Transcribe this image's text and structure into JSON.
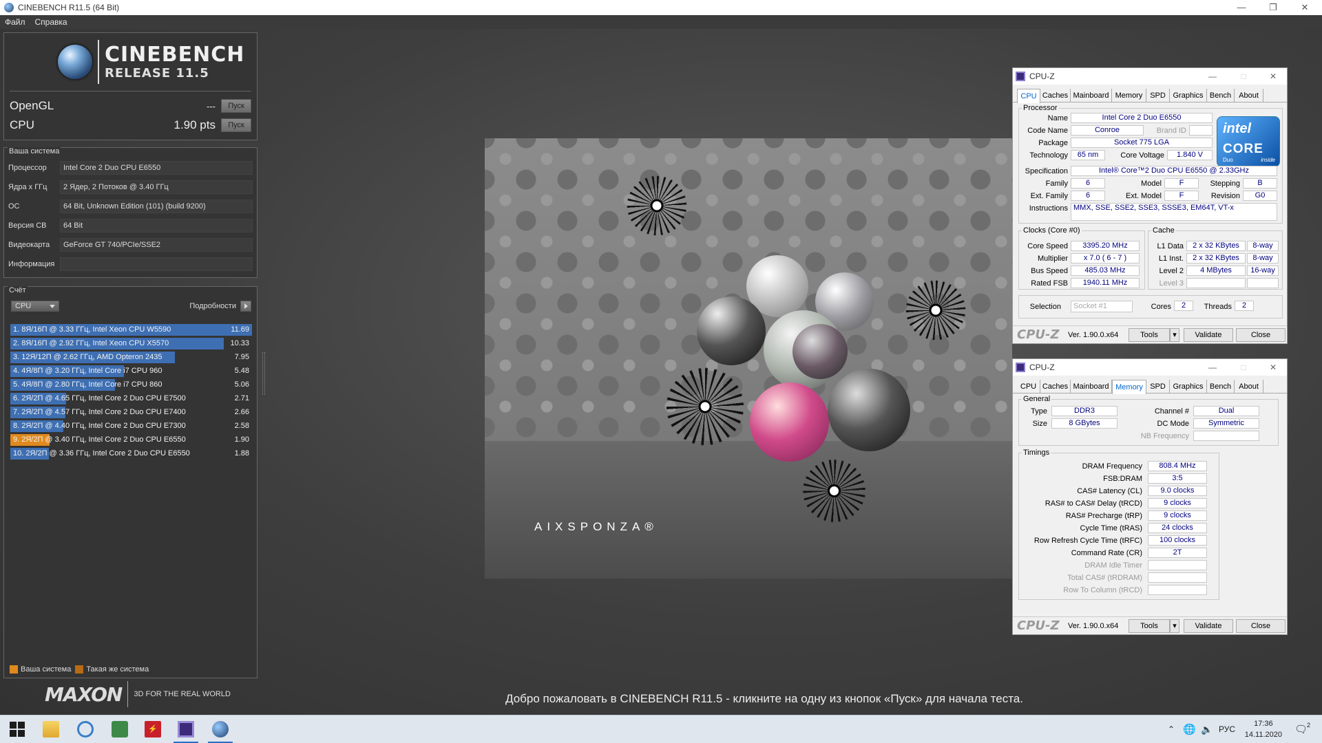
{
  "window": {
    "title": "CINEBENCH R11.5 (64 Bit)"
  },
  "menu": [
    "Файл",
    "Справка"
  ],
  "logo": {
    "line1": "CINEBENCH",
    "line2": "RELEASE 11.5"
  },
  "tests": [
    {
      "name": "OpenGL",
      "score": "---",
      "button": "Пуск"
    },
    {
      "name": "CPU",
      "score": "1.90 pts",
      "button": "Пуск"
    }
  ],
  "system": {
    "title": "Ваша система",
    "rows": [
      {
        "label": "Процессор",
        "value": "Intel Core 2 Duo CPU E6550"
      },
      {
        "label": "Ядра x ГГц",
        "value": "2 Ядер, 2 Потоков @ 3.40 ГГц"
      },
      {
        "label": "ОС",
        "value": "64 Bit, Unknown Edition (101) (build 9200)"
      },
      {
        "label": "Версия СВ",
        "value": "64 Bit"
      },
      {
        "label": "Видеокарта",
        "value": "GeForce GT 740/PCIe/SSE2"
      },
      {
        "label": "Информация",
        "value": ""
      }
    ]
  },
  "score": {
    "title": "Счёт",
    "select": "CPU",
    "details": "Подробности",
    "max": 11.69,
    "ranking": [
      {
        "label": "1. 8Я/16П @ 3.33 ГГц, Intel Xeon CPU W5590",
        "value": 11.69,
        "mine": false
      },
      {
        "label": "2. 8Я/16П @ 2.92 ГГц, Intel Xeon CPU X5570",
        "value": 10.33,
        "mine": false
      },
      {
        "label": "3. 12Я/12П @ 2.62 ГГц, AMD Opteron 2435",
        "value": 7.95,
        "mine": false
      },
      {
        "label": "4. 4Я/8П @ 3.20 ГГц, Intel Core i7 CPU 960",
        "value": 5.48,
        "mine": false
      },
      {
        "label": "5. 4Я/8П @ 2.80 ГГц, Intel Core i7 CPU 860",
        "value": 5.06,
        "mine": false
      },
      {
        "label": "6. 2Я/2П @ 4.65 ГГц, Intel Core 2 Duo CPU E7500",
        "value": 2.71,
        "mine": false
      },
      {
        "label": "7. 2Я/2П @ 4.57 ГГц, Intel Core 2 Duo CPU E7400",
        "value": 2.66,
        "mine": false
      },
      {
        "label": "8. 2Я/2П @ 4.40 ГГц, Intel Core 2 Duo CPU E7300",
        "value": 2.58,
        "mine": false
      },
      {
        "label": "9. 2Я/2П @ 3.40 ГГц, Intel Core 2 Duo CPU E6550",
        "value": 1.9,
        "mine": true
      },
      {
        "label": "10. 2Я/2П @ 3.36 ГГц, Intel Core 2 Duo CPU E6550",
        "value": 1.88,
        "mine": false
      }
    ],
    "legend": [
      {
        "label": "Ваша система",
        "color": "#e08a1e"
      },
      {
        "label": "Такая же система",
        "color": "#b86a14"
      }
    ]
  },
  "maxon": {
    "logo": "MAXON",
    "tagline": "3D FOR THE REAL WORLD"
  },
  "welcome": "Добро пожаловать в CINEBENCH R11.5 - кликните на одну из кнопок «Пуск» для начала теста.",
  "render": {
    "brand": "AIXSPONZA®"
  },
  "cpuz1": {
    "title": "CPU-Z",
    "tabs": [
      "CPU",
      "Caches",
      "Mainboard",
      "Memory",
      "SPD",
      "Graphics",
      "Bench",
      "About"
    ],
    "active": 0,
    "processor": {
      "title": "Processor",
      "name_label": "Name",
      "name": "Intel Core 2 Duo E6550",
      "code_label": "Code Name",
      "code": "Conroe",
      "brand_label": "Brand ID",
      "package_label": "Package",
      "package": "Socket 775 LGA",
      "tech_label": "Technology",
      "tech": "65 nm",
      "voltage_label": "Core Voltage",
      "voltage": "1.840 V",
      "spec_label": "Specification",
      "spec": "Intel® Core™2 Duo CPU     E6550  @ 2.33GHz",
      "family_label": "Family",
      "family": "6",
      "model_label": "Model",
      "model": "F",
      "stepping_label": "Stepping",
      "stepping": "B",
      "extfam_label": "Ext. Family",
      "extfam": "6",
      "extmodel_label": "Ext. Model",
      "extmodel": "F",
      "revision_label": "Revision",
      "revision": "G0",
      "instr_label": "Instructions",
      "instr": "MMX, SSE, SSE2, SSE3, SSSE3, EM64T, VT-x"
    },
    "intel": {
      "brand": "intel",
      "core": "CORE",
      "duo": "Duo",
      "inside": "inside"
    },
    "clocks": {
      "title": "Clocks (Core #0)",
      "speed_label": "Core Speed",
      "speed": "3395.20 MHz",
      "mult_label": "Multiplier",
      "mult": "x 7.0 ( 6 - 7 )",
      "bus_label": "Bus Speed",
      "bus": "485.03 MHz",
      "fsb_label": "Rated FSB",
      "fsb": "1940.11 MHz"
    },
    "cache": {
      "title": "Cache",
      "l1d_label": "L1 Data",
      "l1d": "2 x 32 KBytes",
      "l1d_way": "8-way",
      "l1i_label": "L1 Inst.",
      "l1i": "2 x 32 KBytes",
      "l1i_way": "8-way",
      "l2_label": "Level 2",
      "l2": "4 MBytes",
      "l2_way": "16-way",
      "l3_label": "Level 3"
    },
    "selection_label": "Selection",
    "selection": "Socket #1",
    "cores_label": "Cores",
    "cores": "2",
    "threads_label": "Threads",
    "threads": "2",
    "brand": "CPU-Z",
    "version": "Ver. 1.90.0.x64",
    "tools": "Tools",
    "validate": "Validate",
    "close": "Close"
  },
  "cpuz2": {
    "title": "CPU-Z",
    "tabs": [
      "CPU",
      "Caches",
      "Mainboard",
      "Memory",
      "SPD",
      "Graphics",
      "Bench",
      "About"
    ],
    "active": 3,
    "general": {
      "title": "General",
      "type_label": "Type",
      "type": "DDR3",
      "size_label": "Size",
      "size": "8 GBytes",
      "channel_label": "Channel #",
      "channel": "Dual",
      "dc_label": "DC Mode",
      "dc": "Symmetric",
      "nb_label": "NB Frequency"
    },
    "timings": {
      "title": "Timings",
      "rows": [
        {
          "label": "DRAM Frequency",
          "value": "808.4 MHz",
          "dim": false
        },
        {
          "label": "FSB:DRAM",
          "value": "3:5",
          "dim": false
        },
        {
          "label": "CAS# Latency (CL)",
          "value": "9.0 clocks",
          "dim": false
        },
        {
          "label": "RAS# to CAS# Delay (tRCD)",
          "value": "9 clocks",
          "dim": false
        },
        {
          "label": "RAS# Precharge (tRP)",
          "value": "9 clocks",
          "dim": false
        },
        {
          "label": "Cycle Time (tRAS)",
          "value": "24 clocks",
          "dim": false
        },
        {
          "label": "Row Refresh Cycle Time (tRFC)",
          "value": "100 clocks",
          "dim": false
        },
        {
          "label": "Command Rate (CR)",
          "value": "2T",
          "dim": false
        },
        {
          "label": "DRAM Idle Timer",
          "value": "",
          "dim": true
        },
        {
          "label": "Total CAS# (tRDRAM)",
          "value": "",
          "dim": true
        },
        {
          "label": "Row To Column (tRCD)",
          "value": "",
          "dim": true
        }
      ]
    },
    "brand": "CPU-Z",
    "version": "Ver. 1.90.0.x64",
    "tools": "Tools",
    "validate": "Validate",
    "close": "Close"
  },
  "taskbar": {
    "lang": "РУС",
    "time": "17:36",
    "date": "14.11.2020",
    "notifications": "2"
  }
}
